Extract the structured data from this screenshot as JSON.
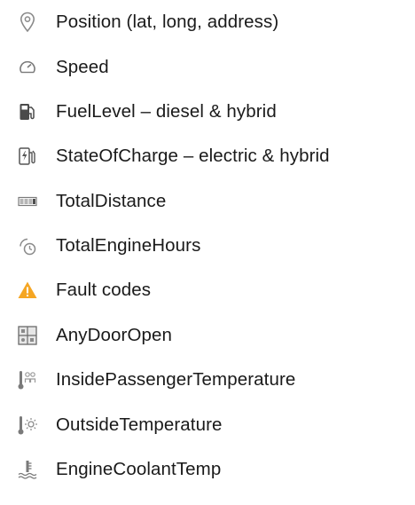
{
  "items": [
    {
      "icon": "location-pin-icon",
      "label": "Position (lat, long, address)"
    },
    {
      "icon": "speedometer-icon",
      "label": "Speed"
    },
    {
      "icon": "fuel-pump-icon",
      "label": "FuelLevel – diesel & hybrid"
    },
    {
      "icon": "charging-station-icon",
      "label": "StateOfCharge – electric & hybrid"
    },
    {
      "icon": "odometer-icon",
      "label": "TotalDistance"
    },
    {
      "icon": "engine-hours-timer-icon",
      "label": "TotalEngineHours"
    },
    {
      "icon": "warning-triangle-icon",
      "label": "Fault codes"
    },
    {
      "icon": "door-open-icon",
      "label": "AnyDoorOpen"
    },
    {
      "icon": "passenger-temperature-icon",
      "label": "InsidePassengerTemperature"
    },
    {
      "icon": "outside-temperature-icon",
      "label": "OutsideTemperature"
    },
    {
      "icon": "coolant-temperature-icon",
      "label": "EngineCoolantTemp"
    }
  ],
  "colors": {
    "text": "#1a1a1a",
    "icon_gray": "#8a8a8a",
    "warning": "#f5a623"
  }
}
